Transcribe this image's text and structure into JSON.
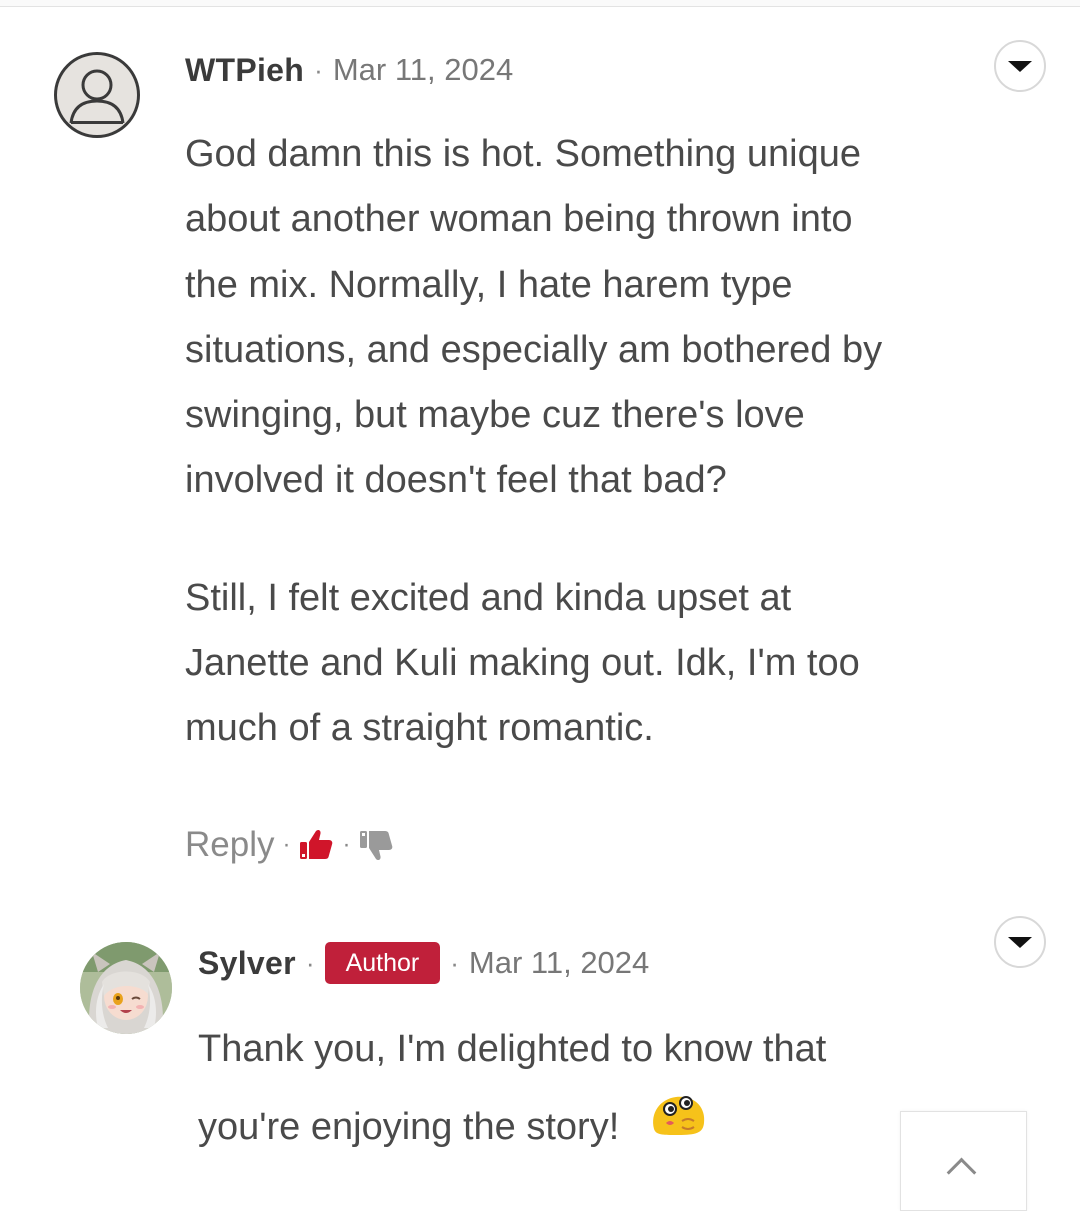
{
  "comments": [
    {
      "username": "WTPieh",
      "separator": "·",
      "date": "Mar 11, 2024",
      "avatar_icon": "default-user-icon",
      "paragraphs": [
        [
          "God damn this is hot. Something unique",
          "about another woman being thrown into",
          "the mix. Normally, I hate harem type",
          "situations, and especially am bothered by",
          "swinging, but maybe cuz there's love",
          "involved it doesn't feel that bad?"
        ],
        [
          "Still, I felt excited and kinda upset at",
          "Janette and Kuli making out. Idk, I'm too",
          "much of a straight romantic."
        ]
      ],
      "actions": {
        "reply_label": "Reply",
        "separator": "·",
        "like_icon": "thumbs-up-icon",
        "dislike_icon": "thumbs-down-icon",
        "like_color": "#d0152a",
        "dislike_color": "#9a9a9a"
      }
    },
    {
      "username": "Sylver",
      "separator": "·",
      "badge": "Author",
      "badge_color": "#c0203a",
      "date": "Mar 11, 2024",
      "avatar_icon": "author-avatar",
      "lines": [
        "Thank you, I'm delighted to know that",
        "you're enjoying the story!"
      ],
      "emoji_icon": "yellow-blob-emoji-icon"
    }
  ],
  "menu_icon": "chevron-down-icon",
  "scroll_top_icon": "chevron-up-icon"
}
